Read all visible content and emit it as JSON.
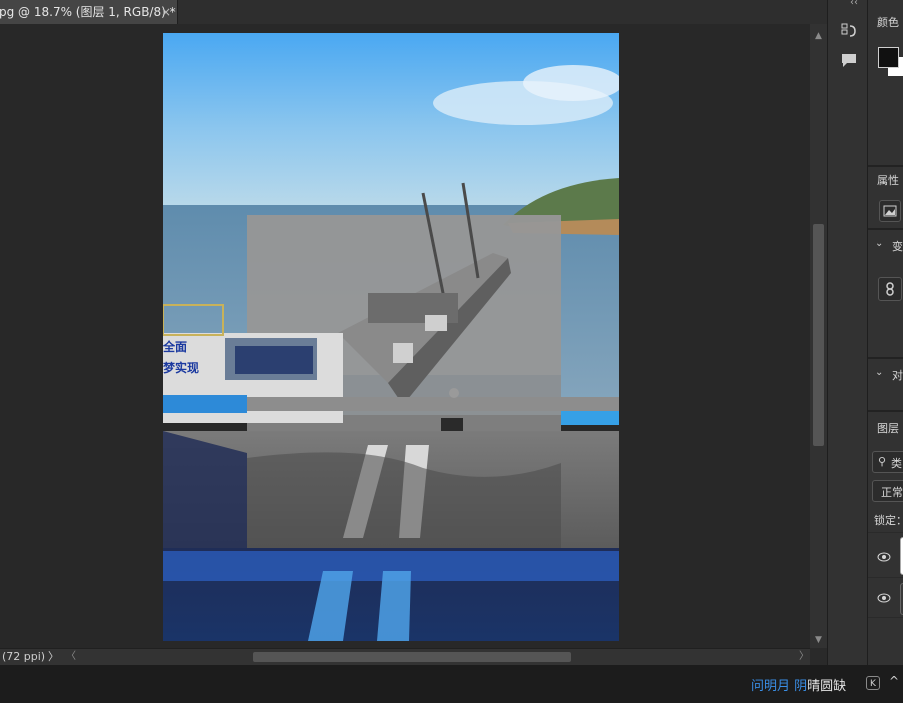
{
  "tab": {
    "title": "pg @ 18.7% (图层 1, RGB/8) *",
    "close": "×"
  },
  "status": {
    "zoom": "(72 ppi)",
    "arrow": "〉"
  },
  "scroll": {
    "up": "▲",
    "down": "▼",
    "left": "〈",
    "right": "〉"
  },
  "taskbar": {
    "part1": "问明月",
    "part2": "阴",
    "part3": "晴圆缺",
    "icon": "K",
    "chevron": "^"
  },
  "panels": {
    "color": "颜色",
    "properties": "属性",
    "transform": "变",
    "align": "对",
    "layers": "图层",
    "search": "类",
    "blend": "正常",
    "lock": "锁定："
  },
  "collapse": "‹‹"
}
